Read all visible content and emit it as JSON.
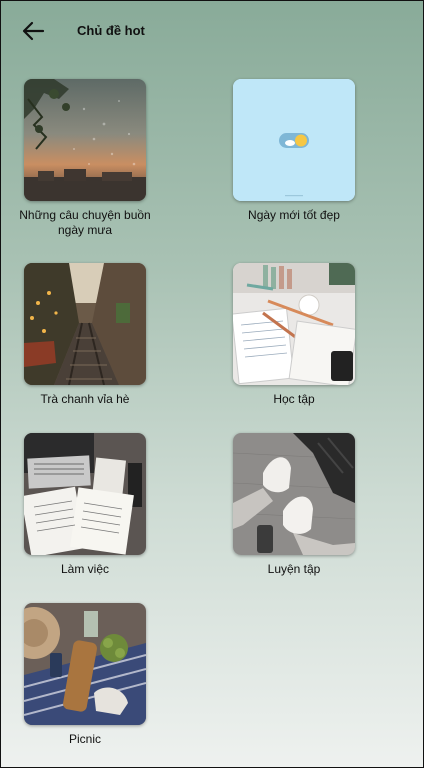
{
  "header": {
    "title": "Chủ đề hot",
    "back_icon": "arrow-left-icon"
  },
  "topics": [
    {
      "label": "Những câu chuyện buồn ngày mưa",
      "image": "rainy-window-sunset-image"
    },
    {
      "label": "Ngày mới tốt đẹp",
      "image": "toggle-sun-cloud-image"
    },
    {
      "label": "Trà chanh vỉa hè",
      "image": "street-railway-image"
    },
    {
      "label": "Học tập",
      "image": "study-desk-image"
    },
    {
      "label": "Làm việc",
      "image": "laptop-notebook-image"
    },
    {
      "label": "Luyện tập",
      "image": "sneakers-foam-roller-image"
    },
    {
      "label": "Picnic",
      "image": "picnic-food-image"
    }
  ],
  "colors": {
    "background_top": "#89ab99",
    "background_bottom": "#eef1ef",
    "light_blue_tile": "#bfe7f8"
  }
}
